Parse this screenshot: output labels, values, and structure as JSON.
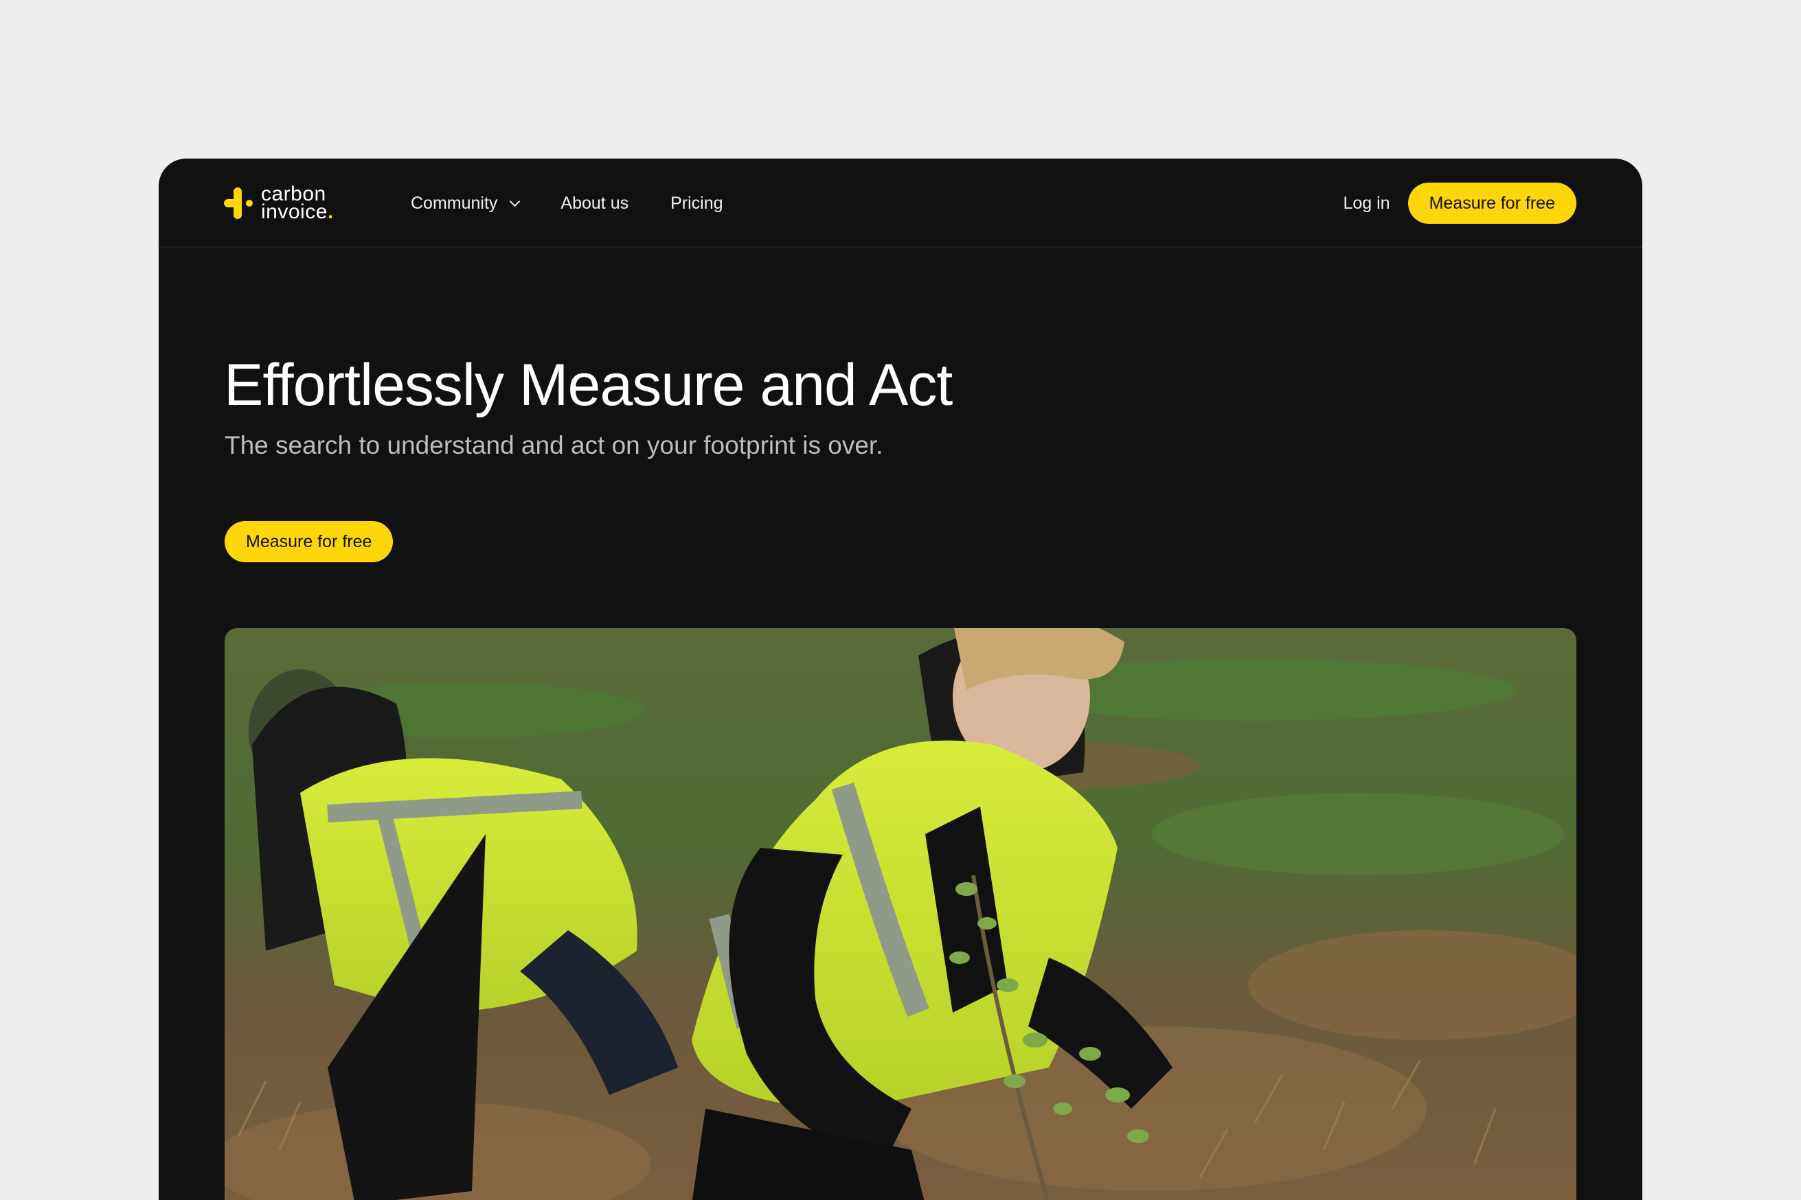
{
  "brand": {
    "line1": "carbon",
    "line2": "invoice",
    "dot": ".",
    "accent_color": "#ffd60a"
  },
  "nav": {
    "items": [
      {
        "label": "Community",
        "has_dropdown": true,
        "icon": "chevron-down-icon"
      },
      {
        "label": "About us"
      },
      {
        "label": "Pricing"
      }
    ],
    "login_label": "Log in",
    "cta_label": "Measure for free"
  },
  "hero": {
    "title": "Effortlessly Measure and Act",
    "subtitle": "The search to understand and act on your footprint is over.",
    "cta_label": "Measure for free",
    "image_description_icon": "photo-tree-planting"
  },
  "colors": {
    "page_background": "#eeeeee",
    "frame_background": "#111111",
    "button_yellow": "#ffd60a",
    "text_primary": "#ffffff",
    "text_secondary": "#bdbdbd"
  }
}
